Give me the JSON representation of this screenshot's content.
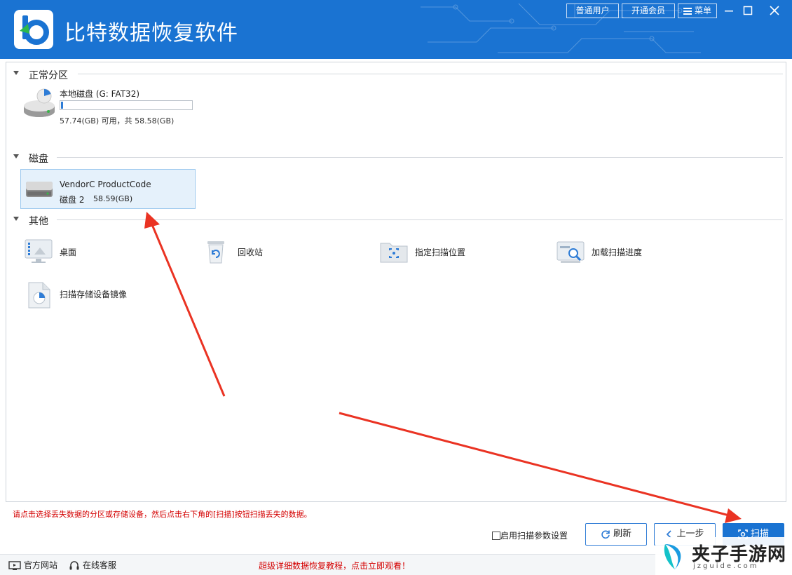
{
  "app": {
    "title": "比特数据恢复软件",
    "brand_color": "#1a73d2"
  },
  "header": {
    "user_button": "普通用户",
    "vip_button": "开通会员",
    "menu_button": "菜单"
  },
  "groups": {
    "normal_partition": {
      "title": "正常分区",
      "drive": {
        "name": "本地磁盘 (G: FAT32)",
        "space": "57.74(GB) 可用，共 58.58(GB)",
        "used_fraction": 0.014,
        "icon": "usb-drive-icon"
      }
    },
    "disk": {
      "title": "磁盘",
      "item": {
        "name": "VendorC ProductCode",
        "label": "磁盘 2",
        "size": "58.59(GB)",
        "icon": "hard-disk-icon"
      }
    },
    "other": {
      "title": "其他",
      "items": [
        {
          "label": "桌面",
          "icon": "desktop-icon"
        },
        {
          "label": "回收站",
          "icon": "recycle-bin-icon"
        },
        {
          "label": "指定扫描位置",
          "icon": "folder-scan-icon"
        },
        {
          "label": "加载扫描进度",
          "icon": "load-progress-icon"
        },
        {
          "label": "扫描存储设备镜像",
          "icon": "disk-image-icon"
        }
      ]
    }
  },
  "hint": "请点击选择丢失数据的分区或存储设备，然后点击右下角的[扫描]按钮扫描丢失的数据。",
  "options": {
    "scan_params_label": "启用扫描参数设置",
    "scan_params_checked": false
  },
  "buttons": {
    "refresh": "刷新",
    "previous": "上一步",
    "scan": "扫描"
  },
  "status": {
    "website": "官方网站",
    "support": "在线客服",
    "promo": "超级详细数据恢复教程，点击立即观看！"
  },
  "watermark": {
    "text": "夹子手游网",
    "sub": "jzguide.com"
  }
}
